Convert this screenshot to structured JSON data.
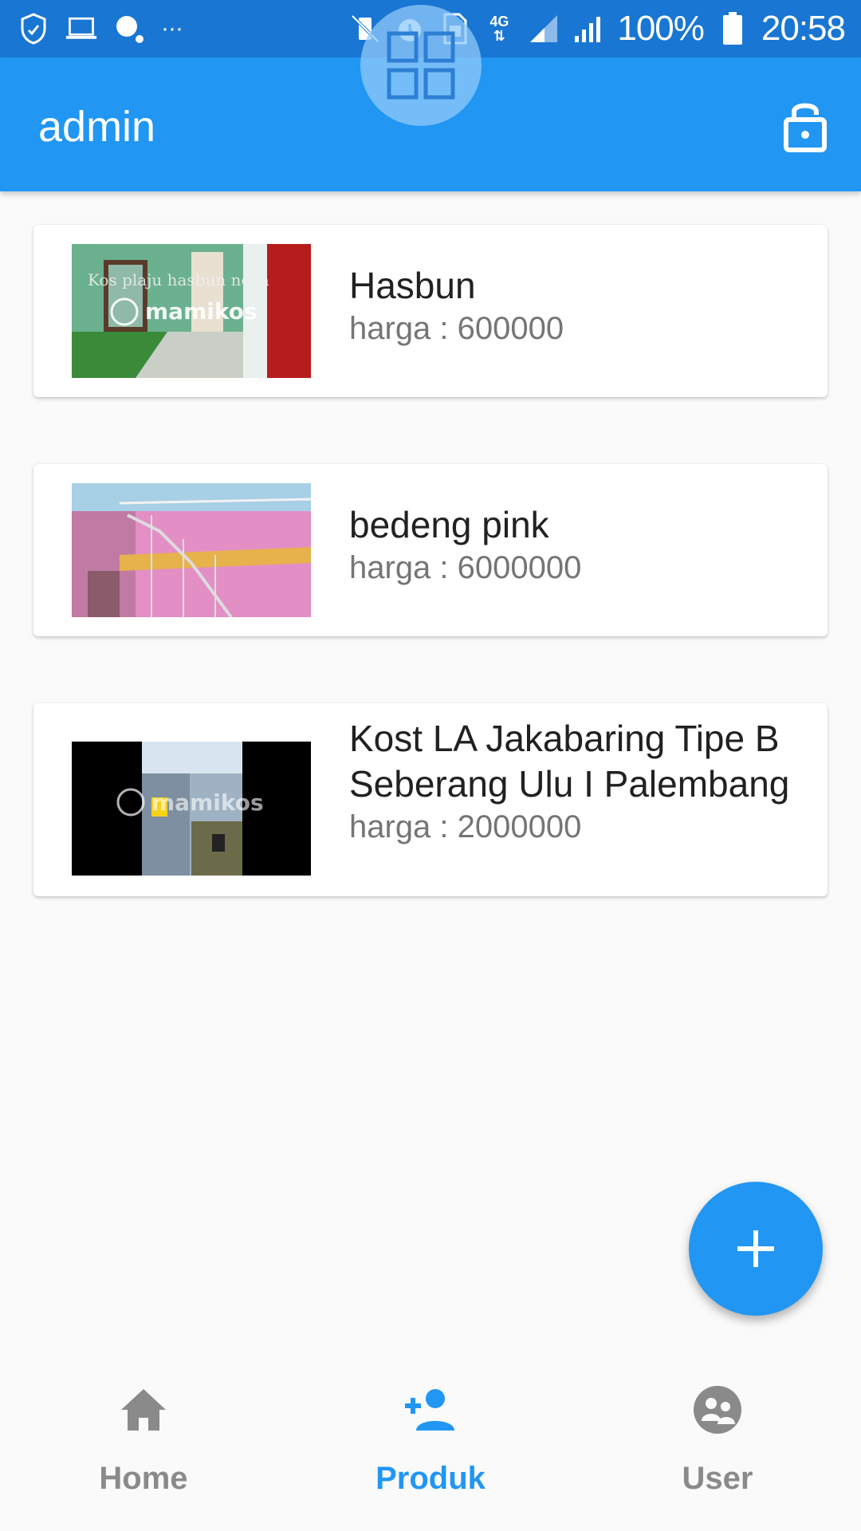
{
  "status_bar": {
    "battery_percent": "100%",
    "time": "20:58",
    "network": "4G",
    "more": "···"
  },
  "app_bar": {
    "title": "admin",
    "lock_icon": "lock-open-icon"
  },
  "overlay": {
    "icon": "grid-icon"
  },
  "listings": [
    {
      "name": "Hasbun",
      "price": "harga : 600000",
      "image_caption": "Kos plaju hasbun nova",
      "watermark": "mamikos"
    },
    {
      "name": "bedeng pink",
      "price": "harga : 6000000"
    },
    {
      "name": "Kost LA Jakabaring Tipe B Seberang Ulu I Palembang",
      "price": "harga : 2000000",
      "watermark": "mamikos"
    }
  ],
  "fab": {
    "icon": "plus-icon"
  },
  "bottom_nav": {
    "items": [
      {
        "label": "Home",
        "icon": "home-icon",
        "active": false
      },
      {
        "label": "Produk",
        "icon": "person-add-icon",
        "active": true
      },
      {
        "label": "User",
        "icon": "group-icon",
        "active": false
      }
    ],
    "active_color": "#2196f3",
    "inactive_color": "#8a8a8a"
  },
  "colors": {
    "primary": "#2196f3",
    "primary_dark": "#1976d2"
  }
}
